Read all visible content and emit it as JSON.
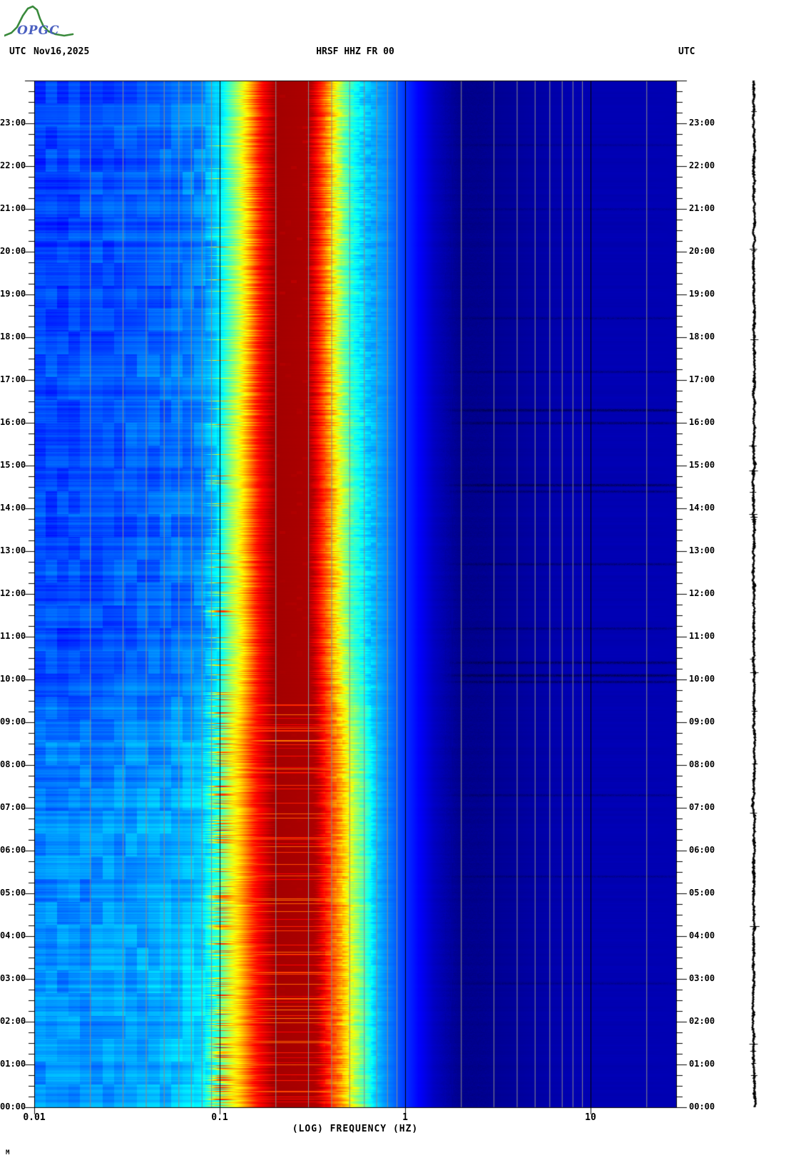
{
  "header": {
    "utc_left": "UTC",
    "date": "Nov16,2025",
    "title": "HRSF HHZ FR 00",
    "utc_right": "UTC"
  },
  "logo": {
    "text": "OPGC",
    "green": "#3a8a3c",
    "blue": "#4a5fc0"
  },
  "footer_mark": "M",
  "x_axis": {
    "label": "(LOG) FREQUENCY (HZ)",
    "ticks": [
      {
        "value": 0.01,
        "label": "0.01"
      },
      {
        "value": 0.1,
        "label": "0.1"
      },
      {
        "value": 1,
        "label": "1"
      },
      {
        "value": 10,
        "label": "10"
      }
    ]
  },
  "y_axis": {
    "unit": "UTC",
    "hour_labels": [
      "00:00",
      "01:00",
      "02:00",
      "03:00",
      "04:00",
      "05:00",
      "06:00",
      "07:00",
      "08:00",
      "09:00",
      "10:00",
      "11:00",
      "12:00",
      "13:00",
      "14:00",
      "15:00",
      "16:00",
      "17:00",
      "18:00",
      "19:00",
      "20:00",
      "21:00",
      "22:00",
      "23:00"
    ],
    "labels_on_both_sides": true
  },
  "chart_data": {
    "type": "heatmap",
    "title": "HRSF HHZ FR 00",
    "date_utc": "Nov16,2025",
    "description": "24-hour seismic spectrogram (power vs log-frequency vs UTC time) with microseism peak near 0.15-0.3 Hz, plus side amplitude trace",
    "x_axis": {
      "scale": "log",
      "min_hz": 0.01,
      "max_hz": 29,
      "label": "(LOG) FREQUENCY (HZ)",
      "decade_ticks": [
        0.01,
        0.1,
        1,
        10
      ]
    },
    "y_axis": {
      "label": "UTC",
      "min_hour": 0,
      "max_hour": 24,
      "tick_minutes": 15,
      "label_minutes": 60,
      "origin": "bottom"
    },
    "colormap": "jet",
    "grid": {
      "minor_color": "#8c8c8c",
      "decade_color": "#000000",
      "border_color": "#000000"
    },
    "spectrum_profile_logf_to_level": [
      [
        -2.0,
        0.19
      ],
      [
        -1.6,
        0.205
      ],
      [
        -1.3,
        0.225
      ],
      [
        -1.1,
        0.26
      ],
      [
        -1.03,
        0.32
      ],
      [
        -0.98,
        0.37
      ],
      [
        -0.92,
        0.5
      ],
      [
        -0.86,
        0.64
      ],
      [
        -0.78,
        0.86
      ],
      [
        -0.7,
        0.965
      ],
      [
        -0.52,
        0.955
      ],
      [
        -0.44,
        0.8
      ],
      [
        -0.38,
        0.63
      ],
      [
        -0.32,
        0.47
      ],
      [
        -0.24,
        0.36
      ],
      [
        -0.1,
        0.26
      ],
      [
        0.0,
        0.175
      ],
      [
        0.15,
        0.07
      ],
      [
        0.3,
        0.02
      ],
      [
        0.55,
        0.025
      ],
      [
        0.9,
        0.05
      ],
      [
        1.46,
        0.05
      ]
    ],
    "time_modulation": {
      "low_freq_boost": [
        [
          0,
          0.1
        ],
        [
          3,
          0.1
        ],
        [
          8.5,
          0.08
        ],
        [
          10.5,
          0.03
        ],
        [
          24,
          0.022
        ]
      ],
      "core_widen": [
        [
          0,
          0.28
        ],
        [
          8.5,
          0.26
        ],
        [
          10.5,
          0.1
        ],
        [
          15,
          0.1
        ],
        [
          18,
          0.02
        ],
        [
          24,
          0.02
        ]
      ],
      "core_center_shift": [
        [
          0,
          -0.06
        ],
        [
          9,
          -0.04
        ],
        [
          11,
          0
        ],
        [
          24,
          0
        ]
      ],
      "core_fragmentation": [
        [
          0,
          0.05
        ],
        [
          10.5,
          0.06
        ],
        [
          12,
          0.13
        ],
        [
          17.5,
          0.14
        ],
        [
          19,
          0.21
        ],
        [
          24,
          0.22
        ]
      ],
      "cyan_streak_prob": [
        [
          0,
          0.38
        ],
        [
          9.5,
          0.3
        ],
        [
          10.5,
          0.06
        ],
        [
          24,
          0.05
        ]
      ]
    },
    "cyan_band_streaks": {
      "center_logf": -1.0,
      "sigma_logf": 0.06,
      "strength_min": 0.12,
      "strength_max": 0.45
    },
    "core_red_streaks": {
      "before_hour": 9.5,
      "probability": 0.13,
      "strength_min": 0.06,
      "strength_max": 0.26
    },
    "events_utc_hours": [
      {
        "utc": 18.45,
        "strength": 0.02
      },
      {
        "utc": 17.2,
        "strength": 0.025
      },
      {
        "utc": 16.3,
        "strength": 0.05
      },
      {
        "utc": 16.0,
        "strength": 0.04
      },
      {
        "utc": 14.55,
        "strength": 0.05
      },
      {
        "utc": 14.4,
        "strength": 0.03
      },
      {
        "utc": 12.7,
        "strength": 0.03
      },
      {
        "utc": 11.2,
        "strength": 0.025
      },
      {
        "utc": 10.4,
        "strength": 0.05
      },
      {
        "utc": 10.1,
        "strength": 0.06
      },
      {
        "utc": 9.95,
        "strength": 0.04
      },
      {
        "utc": 7.3,
        "strength": 0.02
      },
      {
        "utc": 5.4,
        "strength": 0.018
      },
      {
        "utc": 2.9,
        "strength": 0.015
      },
      {
        "utc": 21.0,
        "strength": 0.015
      },
      {
        "utc": 22.5,
        "strength": 0.012
      }
    ],
    "side_trace": {
      "present": true,
      "color": "#000000"
    }
  },
  "colors": {
    "page_bg": "#ffffff",
    "text": "#000000",
    "grid_minor": "#8c8c8c",
    "grid_decade": "#000000",
    "trace": "#000000"
  }
}
